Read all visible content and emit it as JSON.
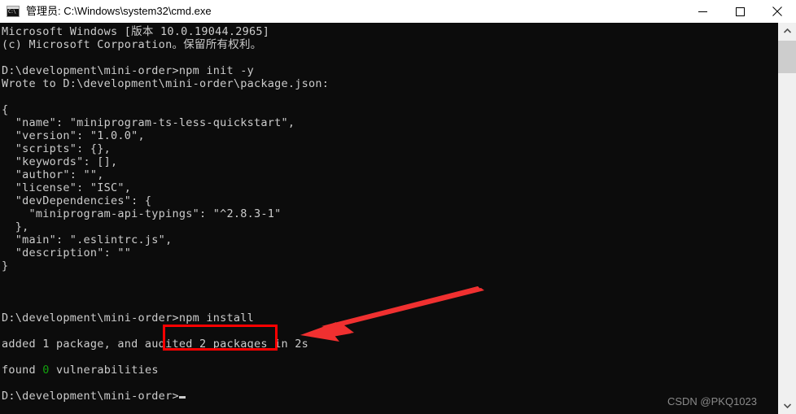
{
  "window": {
    "title": "管理员: C:\\Windows\\system32\\cmd.exe",
    "icon": "cmd-console-icon",
    "background_color": "#0c0c0c",
    "foreground_color": "#cccccc"
  },
  "controls": {
    "minimize_label": "Minimize",
    "maximize_label": "Maximize",
    "close_label": "Close"
  },
  "console": {
    "prompt": "D:\\development\\mini-order>",
    "lines_before_green": "Microsoft Windows [版本 10.0.19044.2965]\n(c) Microsoft Corporation。保留所有权利。\n\nD:\\development\\mini-order>npm init -y\nWrote to D:\\development\\mini-order\\package.json:\n\n{\n  \"name\": \"miniprogram-ts-less-quickstart\",\n  \"version\": \"1.0.0\",\n  \"scripts\": {},\n  \"keywords\": [],\n  \"author\": \"\",\n  \"license\": \"ISC\",\n  \"devDependencies\": {\n    \"miniprogram-api-typings\": \"^2.8.3-1\"\n  },\n  \"main\": \".eslintrc.js\",\n  \"description\": \"\"\n}\n\n\n\nD:\\development\\mini-order>npm install\n\nadded 1 package, and audited 2 packages in 2s\n\nfound ",
    "green_token": "0",
    "lines_after_green": " vulnerabilities\n\nD:\\development\\mini-order>",
    "green_color": "#13a10e",
    "commands": [
      "npm init -y",
      "npm install"
    ],
    "package_json": {
      "name": "miniprogram-ts-less-quickstart",
      "version": "1.0.0",
      "scripts": {},
      "keywords": [],
      "author": "",
      "license": "ISC",
      "devDependencies": {
        "miniprogram-api-typings": "^2.8.3-1"
      },
      "main": ".eslintrc.js",
      "description": ""
    },
    "install_result": {
      "added_packages": "added 1 package, and audited 2 packages in 2s",
      "vulnerabilities": "found 0 vulnerabilities"
    }
  },
  "annotations": {
    "highlight_box_color": "#ff0000",
    "highlight_box_target": "npm install",
    "arrow_color": "#f03030",
    "arrow_label": "pointer-arrow"
  },
  "watermark": {
    "text": "CSDN @PKQ1023"
  },
  "scrollbar": {
    "up_label": "Scroll up",
    "down_label": "Scroll down",
    "thumb_label": "Scroll thumb"
  }
}
